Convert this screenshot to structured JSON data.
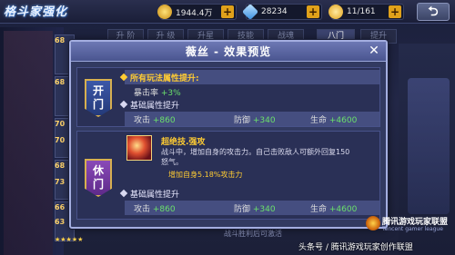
{
  "header": {
    "game_title": "格斗家强化",
    "gold": "1944.4万",
    "diamonds": "28234",
    "stamina": "11/161",
    "back_symbol": "⮌"
  },
  "bg_tabs": [
    "升 阶",
    "升 级",
    "升星",
    "技能",
    "战魂",
    "八门",
    "提升"
  ],
  "bg_side_levels": [
    "68",
    "68",
    "70",
    "70",
    "68",
    "73",
    "66",
    "63"
  ],
  "bg_bottom_note": "战斗胜利后可激活",
  "modal": {
    "title": "薇丝 - 效果预览",
    "close_symbol": "✕",
    "sections": [
      {
        "gate": "开\n门",
        "all_mode_label": "所有玩法属性提升:",
        "crit_label": "暴击率",
        "crit_value": "+3%",
        "base_label": "基础属性提升",
        "stats": [
          {
            "label": "攻击",
            "value": "+860"
          },
          {
            "label": "防御",
            "value": "+340"
          },
          {
            "label": "生命",
            "value": "+4600"
          }
        ]
      },
      {
        "gate": "休\n门",
        "skill_name": "超绝技.强攻",
        "skill_desc_1": "战斗中，增加自身的攻击力。自己击败敌人可额外回复150",
        "skill_desc_2": "怒气。",
        "skill_extra": "增加自身5.18%攻击力",
        "base_label": "基础属性提升",
        "stats": [
          {
            "label": "攻击",
            "value": "+860"
          },
          {
            "label": "防御",
            "value": "+340"
          },
          {
            "label": "生命",
            "value": "+4600"
          }
        ]
      }
    ]
  },
  "branding": {
    "logo_text": "腾讯游戏玩家联盟",
    "logo_sub": "Tencent gamer league",
    "watermark": "头条号 / 腾讯游戏玩家创作联盟"
  },
  "colors": {
    "accent_gold": "#ffcc33",
    "positive_green": "#6be06b",
    "modal_bg": "#323a61"
  }
}
